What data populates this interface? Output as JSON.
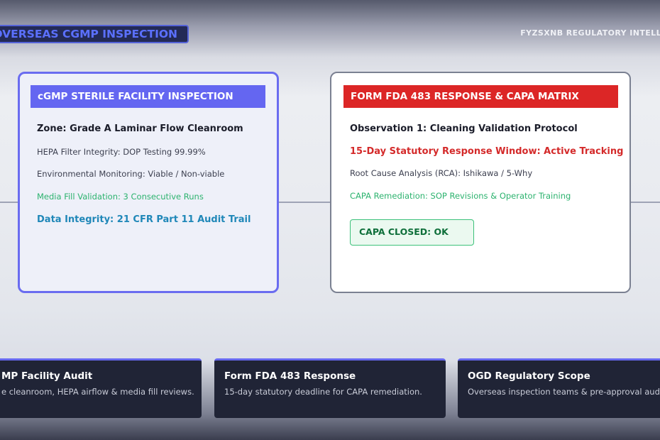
{
  "header": {
    "title": "A OVERSEAS CGMP INSPECTION",
    "brand": "FYZSXNB REGULATORY INTELL"
  },
  "facility_card": {
    "title": "cGMP STERILE FACILITY INSPECTION",
    "zone": "Zone: Grade A Laminar Flow Cleanroom",
    "hepa": "HEPA Filter Integrity: DOP Testing 99.99%",
    "env": "Environmental Monitoring: Viable / Non-viable",
    "media": "Media Fill Validation: 3 Consecutive Runs",
    "integrity": "Data Integrity: 21 CFR Part 11 Audit Trail"
  },
  "capa_card": {
    "title": "FORM FDA 483 RESPONSE & CAPA MATRIX",
    "observation": "Observation 1: Cleaning Validation Protocol",
    "window": "15-Day Statutory Response Window: Active Tracking",
    "rca": "Root Cause Analysis (RCA): Ishikawa / 5-Why",
    "remediation": "CAPA Remediation: SOP Revisions & Operator Training",
    "status": "CAPA CLOSED: OK"
  },
  "tiles": [
    {
      "title": "MP Facility Audit",
      "desc": "e cleanroom, HEPA airflow & media fill reviews."
    },
    {
      "title": "Form FDA 483 Response",
      "desc": "15-day statutory deadline for CAPA remediation."
    },
    {
      "title": "OGD Regulatory Scope",
      "desc": "Overseas inspection teams & pre-approval audits"
    }
  ],
  "colors": {
    "accent": "#6466f1",
    "alert": "#dc2626",
    "ok": "#3cc17a",
    "tile_bg": "#202436"
  }
}
